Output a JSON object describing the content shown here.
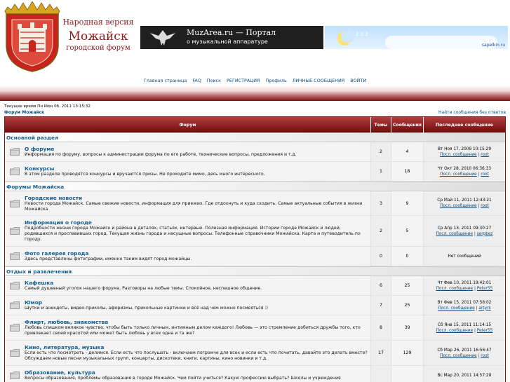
{
  "header": {
    "logo_line1": "Народная версия",
    "logo_line2": "Можайск",
    "logo_line3": "городской форум",
    "banner1_title": "MuzArea.ru — Портал",
    "banner1_subtitle": "о музыкальной аппаратуре",
    "banner2_url": "sapelkin.ru"
  },
  "nav": {
    "home": "Главная страница",
    "faq": "FAQ",
    "search": "Поиск",
    "register": "РЕГИСТРАЦИЯ",
    "profile": "Профиль",
    "messages": "ЛИЧНЫЕ СООБЩЕНИЯ",
    "login": "ВОЙТИ"
  },
  "info": {
    "current_time": "Текущее время Пн Июн 06, 2011 13:15:32",
    "forum_link": "Форум Можайск",
    "no_answer": "Найти сообщения без ответов"
  },
  "table_headers": {
    "forum": "Форум",
    "topics": "Темы",
    "posts": "Сообщения",
    "last_post": "Последнее сообщение"
  },
  "categories": [
    {
      "title": "Основной раздел",
      "forums": [
        {
          "name": "О форуме",
          "desc": "Информация по форуму, вопросы к администрации форума по его работе, технические вопросы, предложения и т.д.",
          "topics": "2",
          "posts": "4",
          "last_date": "Вт Ноя 17, 2009 10:15:29",
          "last_label": "Посл. сообщение",
          "last_author": "root"
        },
        {
          "name": "Конкурсы",
          "desc": "В этом разделе проводятся конкурсы и вручаются призы. Не проходите мимо, десь много интересного.",
          "topics": "1",
          "posts": "18",
          "last_date": "Чт Окт 28, 2010 06:36:33",
          "last_label": "Посл. сообщение",
          "last_author": "root"
        }
      ]
    },
    {
      "title": "Форумы Можайска",
      "forums": [
        {
          "name": "Городские новости",
          "desc": "Новости города Можайск. Самые свежие новости, информация для приежих. Где отдохнуть и куда сходить. Самые актуальные события в жизни Можайска",
          "topics": "3",
          "posts": "9",
          "last_date": "Ср Май 11, 2011 12:43:21",
          "last_label": "Посл. сообщение",
          "last_author": "root"
        },
        {
          "name": "Информация о городе",
          "desc": "Подробности жизни города Можайск и района в деталях, статьях, интервью. Полезная информация. Истории города Можайск и людей, родившихся и прославивших город. Текущая жизнь города и насущные вопросы. Телефонные справочники Можайска. Карта и путеводитель по городу.",
          "topics": "2",
          "posts": "5",
          "last_date": "Ср Апр 13, 2011 09:30:27",
          "last_label": "Посл. сообщение",
          "last_author": "sergbez"
        },
        {
          "name": "Фото галерея города",
          "desc": "Здесь представлены фотографии, именно таким видят город можайцы.",
          "topics": "0",
          "posts": "0",
          "last_date": "Нет сообщений",
          "last_label": "",
          "last_author": ""
        }
      ]
    },
    {
      "title": "Отдых и развлечения",
      "forums": [
        {
          "name": "Кафешка",
          "desc": "Самый душевный уголок нашего форума. Разговоры на любые темы. Спокойное, неспешное общение.",
          "topics": "6",
          "posts": "25",
          "last_date": "Чт Фев 10, 2011 19:42:01",
          "last_label": "Посл. сообщение",
          "last_author": "Peter55"
        },
        {
          "name": "Юмор",
          "desc": "Шутки и анекдоты, видео-приколы, афоризмы, прикольные картинки и всё над чем можно посмеяться :)",
          "topics": "7",
          "posts": "25",
          "last_date": "Вт Фев 15, 2011 07:58:02",
          "last_label": "Посл. сообщение",
          "last_author": "artyrk"
        },
        {
          "name": "Флирт, любовь, знакомства",
          "desc": "Любовь слишком великое чувство, чтобы быть только личным, интимным делом каждого! Любовь — это стремление добиться дружбы того, кто привлекает своей красотой или может быть любовь у всех одна и та же?",
          "topics": "8",
          "posts": "39",
          "last_date": "Сб Янв 15, 2011 11:14:15",
          "last_label": "Посл. сообщение",
          "last_author": "Peter55"
        },
        {
          "name": "Кино, литература, музыка",
          "desc": "Если есть что посмотреть - делимся. Если есть что послушать - включаем погромче для всех и если есть что почитать, давайте это делать вместе? Обсуждаем новые песни музыкальных групп, концерты, дискотеки, книги, картины, кино новинки и т.д.",
          "topics": "17",
          "posts": "129",
          "last_date": "Сб Мар 26, 2011 16:56:47",
          "last_label": "Посл. сообщение",
          "last_author": "root"
        },
        {
          "name": "Образование, культура",
          "desc": "Вопросы образования, проблемы образования в городе Можайск. Чем пойти учиться? Какую профессию выбрать? Школы и учреждения",
          "topics": "",
          "posts": "",
          "last_date": "Вс Мар 20, 2011 14:57:28",
          "last_label": "",
          "last_author": ""
        }
      ]
    }
  ]
}
